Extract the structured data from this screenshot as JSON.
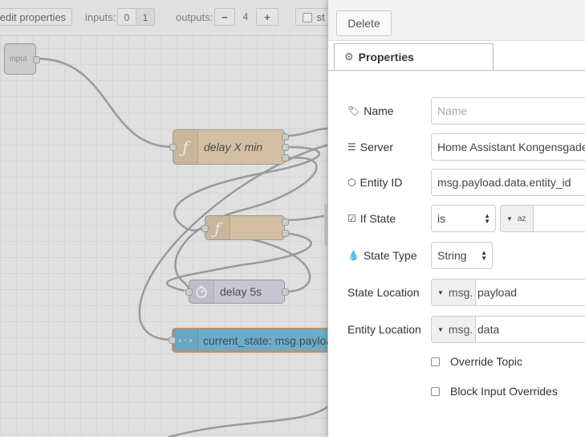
{
  "toolbar": {
    "edit_properties_label": "edit properties",
    "inputs_label": "inputs:",
    "inputs_options": [
      "0",
      "1"
    ],
    "outputs_label": "outputs:",
    "outputs_minus": "−",
    "outputs_value": "4",
    "outputs_plus": "+",
    "truncated_check_label": "st"
  },
  "flow": {
    "input_node_label": "input",
    "delay_x_node_label": "delay X min",
    "delay_5s_node_label": "delay 5s",
    "current_state_node_label": "current_state: msg.payload",
    "function_icon": "ƒ",
    "timer_icon": "timer-icon"
  },
  "tray": {
    "delete_label": "Delete",
    "properties_tab_label": "Properties",
    "fields": {
      "name_label": "Name",
      "name_placeholder": "Name",
      "server_label": "Server",
      "server_value": "Home Assistant Kongensgade",
      "entity_id_label": "Entity ID",
      "entity_id_value": "msg.payload.data.entity_id",
      "if_state_label": "If State",
      "if_state_operator": "is",
      "if_state_type_icon": "az",
      "state_type_label": "State Type",
      "state_type_value": "String",
      "state_location_label": "State Location",
      "state_location_type": "msg.",
      "state_location_value": "payload",
      "entity_location_label": "Entity Location",
      "entity_location_type": "msg.",
      "entity_location_value": "data",
      "override_topic_label": "Override Topic",
      "block_input_overrides_label": "Block Input Overrides"
    }
  },
  "colors": {
    "function_node": "#e2c7a3",
    "delay_node": "#d6d0e3",
    "api_node": "#5cb0d8",
    "selected_outline": "#e8823a"
  }
}
